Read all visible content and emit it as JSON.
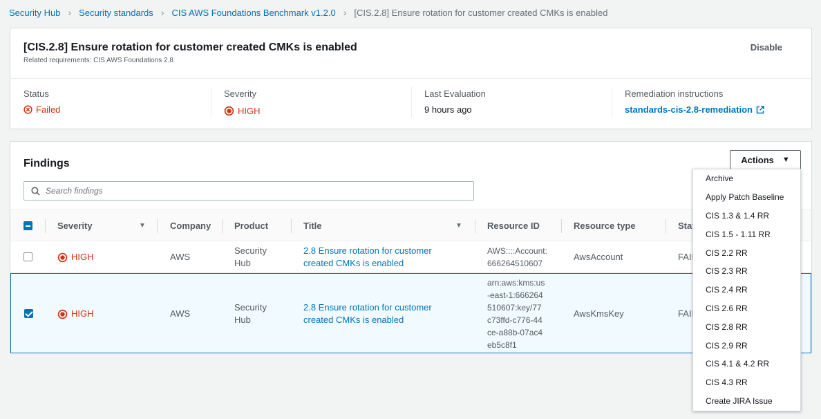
{
  "breadcrumb": {
    "items": [
      "Security Hub",
      "Security standards",
      "CIS AWS Foundations Benchmark v1.2.0"
    ],
    "current": "[CIS.2.8] Ensure rotation for customer created CMKs is enabled",
    "separator": ">"
  },
  "control": {
    "title": "[CIS.2.8] Ensure rotation for customer created CMKs is enabled",
    "related": "Related requirements: CIS AWS Foundations 2.8",
    "disable_label": "Disable",
    "status_label": "Status",
    "status_value": "Failed",
    "severity_label": "Severity",
    "severity_value": "HIGH",
    "last_eval_label": "Last Evaluation",
    "last_eval_value": "9 hours ago",
    "remediation_label": "Remediation instructions",
    "remediation_link": "standards-cis-2.8-remediation"
  },
  "findings": {
    "title": "Findings",
    "actions_label": "Actions",
    "search_placeholder": "Search findings",
    "columns": [
      "Severity",
      "Company",
      "Product",
      "Title",
      "Resource ID",
      "Resource type",
      "Stat"
    ],
    "rows": [
      {
        "checked": false,
        "severity": "HIGH",
        "company": "AWS",
        "product_l1": "Security",
        "product_l2": "Hub",
        "title_l1": "2.8 Ensure rotation for customer",
        "title_l2": "created CMKs is enabled",
        "resource_id_l1": "AWS::::Account:",
        "resource_id_l2": "666264510607",
        "resource_type": "AwsAccount",
        "status": "FAIL"
      },
      {
        "checked": true,
        "severity": "HIGH",
        "company": "AWS",
        "product_l1": "Security",
        "product_l2": "Hub",
        "title_l1": "2.8 Ensure rotation for customer",
        "title_l2": "created CMKs is enabled",
        "resource_id_lines": [
          "arn:aws:kms:us",
          "-east-1:666264",
          "510607:key/77",
          "c73ffd-c776-44",
          "ce-a88b-07ac4",
          "eb5c8f1"
        ],
        "resource_type": "AwsKmsKey",
        "status": "FAIL"
      }
    ]
  },
  "actions_menu": [
    "Archive",
    "Apply Patch Baseline",
    "CIS 1.3 & 1.4 RR",
    "CIS 1.5 - 1.11 RR",
    "CIS 2.2 RR",
    "CIS 2.3 RR",
    "CIS 2.4 RR",
    "CIS 2.6 RR",
    "CIS 2.8 RR",
    "CIS 2.9 RR",
    "CIS 4.1 & 4.2 RR",
    "CIS 4.3 RR",
    "Create JIRA Issue"
  ],
  "colors": {
    "link": "#0073bb",
    "danger": "#d13212",
    "selected_row_bg": "#f1faff"
  }
}
